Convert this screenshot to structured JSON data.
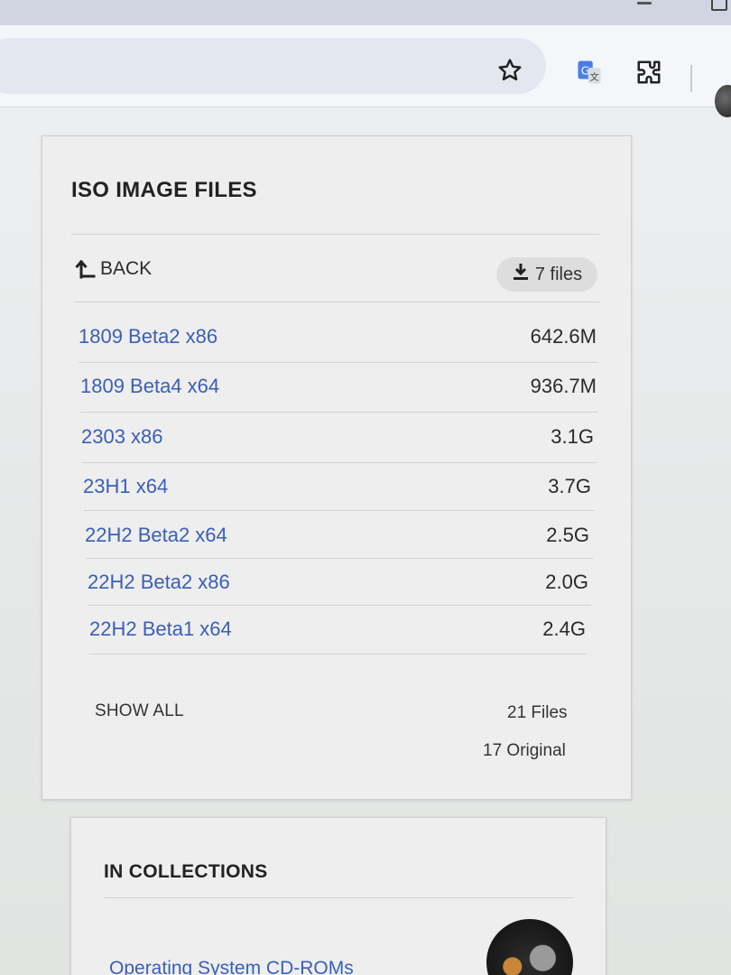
{
  "browser": {
    "icons": [
      "star-icon",
      "translate-icon",
      "extensions-icon"
    ]
  },
  "iso": {
    "title": "ISO IMAGE FILES",
    "back_label": "BACK",
    "download_label": "7 files",
    "files": [
      {
        "name": "1809 Beta2 x86",
        "size": "642.6M"
      },
      {
        "name": "1809 Beta4 x64",
        "size": "936.7M"
      },
      {
        "name": "2303 x86",
        "size": "3.1G"
      },
      {
        "name": "23H1 x64",
        "size": "3.7G"
      },
      {
        "name": "22H2 Beta2 x64",
        "size": "2.5G"
      },
      {
        "name": "22H2 Beta2 x86",
        "size": "2.0G"
      },
      {
        "name": "22H2 Beta1 x64",
        "size": "2.4G"
      }
    ],
    "show_all_label": "SHOW ALL",
    "total_files": "21 Files",
    "original_count": "17 Original"
  },
  "collections": {
    "title": "IN COLLECTIONS",
    "items": [
      {
        "label": "Operating System CD-ROMs"
      }
    ]
  },
  "colors": {
    "link": "#3a5fb8",
    "title": "#222222",
    "card_bg": "#eeeeee"
  }
}
